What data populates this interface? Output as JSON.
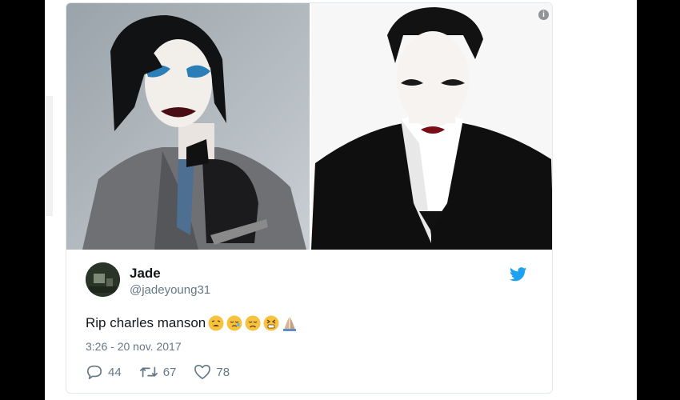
{
  "tweet": {
    "author_name": "Jade",
    "author_handle": "@jadeyoung31",
    "text": "Rip charles manson",
    "emojis": [
      "tired-face-emoji",
      "sleepy-face-emoji",
      "disappointed-face-emoji",
      "persevering-face-emoji",
      "folded-hands-emoji"
    ],
    "timestamp": "3:26 - 20 nov. 2017",
    "replies": "44",
    "retweets": "67",
    "likes": "78",
    "info_icon_glyph": "i"
  },
  "colors": {
    "twitter_blue": "#1da1f2",
    "secondary_text": "#657786",
    "primary_text": "#14171a",
    "border": "#e1e8ed"
  }
}
